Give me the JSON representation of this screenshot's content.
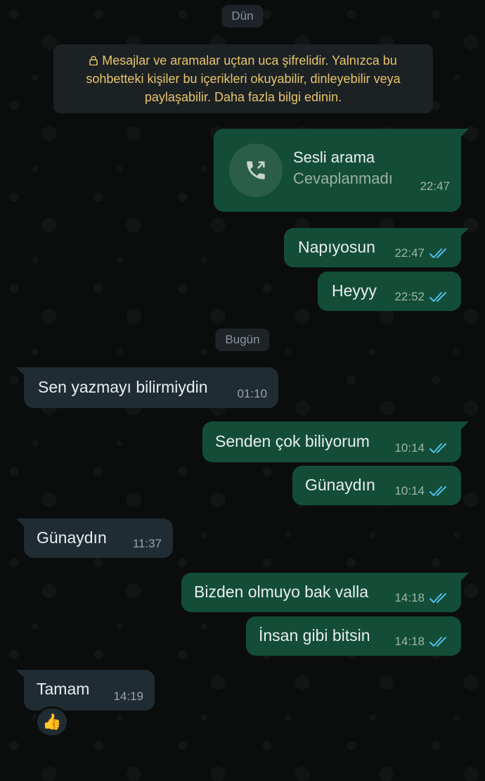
{
  "dates": {
    "yesterday": "Dün",
    "today": "Bugün"
  },
  "encryption_notice": "Mesajlar ve aramalar uçtan uca şifrelidir. Yalnızca bu sohbetteki kişiler bu içerikleri okuyabilir, dinleyebilir veya paylaşabilir. Daha fazla bilgi edinin.",
  "call": {
    "title": "Sesli arama",
    "status": "Cevaplanmadı",
    "time": "22:47",
    "icon": "outgoing-call-icon"
  },
  "messages": [
    {
      "direction": "out",
      "text": "Napıyosun",
      "time": "22:47",
      "status": "read"
    },
    {
      "direction": "out",
      "text": "Heyyy",
      "time": "22:52",
      "status": "read"
    },
    {
      "direction": "in",
      "text": "Sen yazmayı bilirmiydin",
      "time": "01:10"
    },
    {
      "direction": "out",
      "text": "Senden çok biliyorum",
      "time": "10:14",
      "status": "read"
    },
    {
      "direction": "out",
      "text": "Günaydın",
      "time": "10:14",
      "status": "read"
    },
    {
      "direction": "in",
      "text": "Günaydın",
      "time": "11:37"
    },
    {
      "direction": "out",
      "text": "Bizden olmuyo bak valla",
      "time": "14:18",
      "status": "read"
    },
    {
      "direction": "out",
      "text": "İnsan gibi bitsin",
      "time": "14:18",
      "status": "read"
    },
    {
      "direction": "in",
      "text": "Tamam",
      "time": "14:19"
    }
  ],
  "reaction": {
    "emoji": "👍",
    "icon": "thumbs-up-icon"
  },
  "colors": {
    "outgoing_bubble": "#134d37",
    "incoming_bubble": "#202c33",
    "read_ticks": "#53bdeb",
    "notice_text": "#e7c56a"
  }
}
